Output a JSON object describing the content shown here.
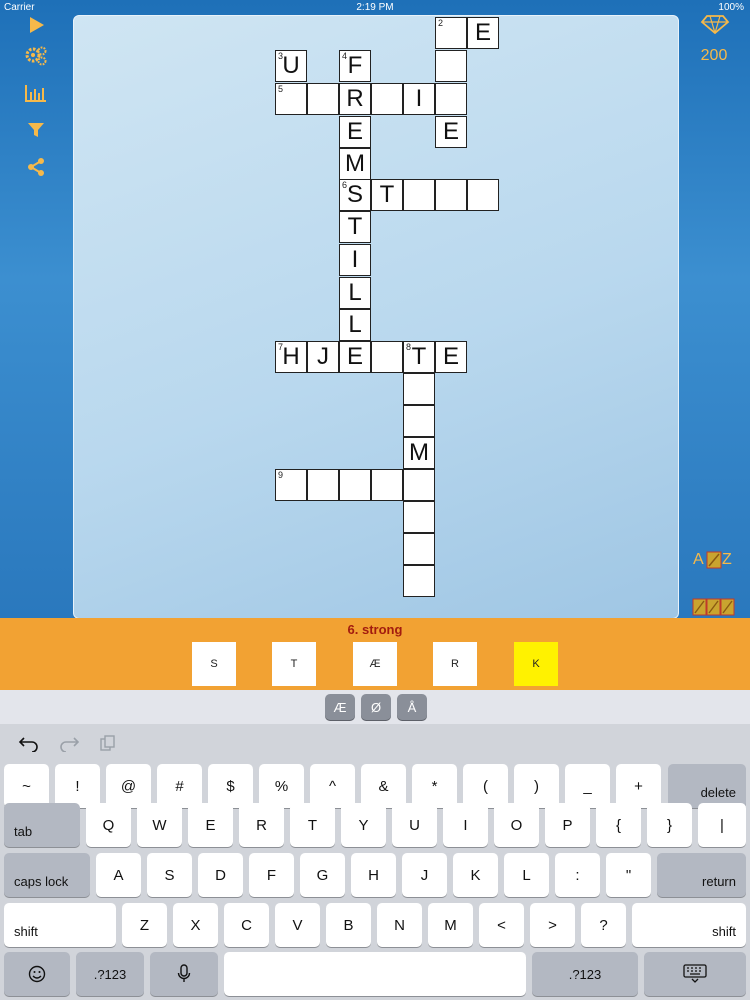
{
  "status": {
    "carrier": "Carrier",
    "time": "2:19 PM",
    "battery": "100%"
  },
  "toolbar": {
    "icons": [
      "play-icon",
      "settings-gears-icon",
      "stats-chart-icon",
      "filter-icon",
      "share-icon"
    ],
    "accent_color": "#f6b94a"
  },
  "score": {
    "gem_icon": "gem-icon",
    "value": "200"
  },
  "sidebar_buttons": {
    "az_label": "A",
    "az_label2": "Z"
  },
  "crossword": {
    "numbers": {
      "n2": "2",
      "n3": "3",
      "n4": "4",
      "n5": "5",
      "n6": "6",
      "n7": "7",
      "n8": "8",
      "n9": "9"
    },
    "letters": {
      "e1": "E",
      "u": "U",
      "f": "F",
      "r": "R",
      "i": "I",
      "e2": "E",
      "e3": "E",
      "m1": "M",
      "s": "S",
      "t1": "T",
      "t2": "T",
      "i2": "I",
      "l1": "L",
      "l2": "L",
      "e4": "E",
      "h": "H",
      "j": "J",
      "e5": "E",
      "t3": "T",
      "e6": "E",
      "m2": "M"
    }
  },
  "clue": {
    "text": "6. strong",
    "tiles": [
      "S",
      "T",
      "Æ",
      "R",
      "K"
    ],
    "selected_index": 4,
    "selected_color": "#fff200",
    "bar_color": "#f2a233"
  },
  "accent_keys": [
    "Æ",
    "Ø",
    "Å"
  ],
  "keyboard": {
    "row1": [
      "~",
      "!",
      "@",
      "#",
      "$",
      "%",
      "^",
      "&",
      "*",
      "(",
      ")",
      "_",
      "+"
    ],
    "delete": "delete",
    "tab": "tab",
    "row2": [
      "Q",
      "W",
      "E",
      "R",
      "T",
      "Y",
      "U",
      "I",
      "O",
      "P",
      "{",
      "}",
      "|"
    ],
    "caps": "caps lock",
    "row3": [
      "A",
      "S",
      "D",
      "F",
      "G",
      "H",
      "J",
      "K",
      "L",
      ":",
      "\""
    ],
    "return": "return",
    "shift": "shift",
    "row4": [
      "Z",
      "X",
      "C",
      "V",
      "B",
      "N",
      "M",
      "<",
      ">",
      "?"
    ],
    "numbers": ".?123",
    "emoji_icon": "emoji-icon",
    "mic_icon": "microphone-icon",
    "hide_icon": "keyboard-hide-icon"
  }
}
